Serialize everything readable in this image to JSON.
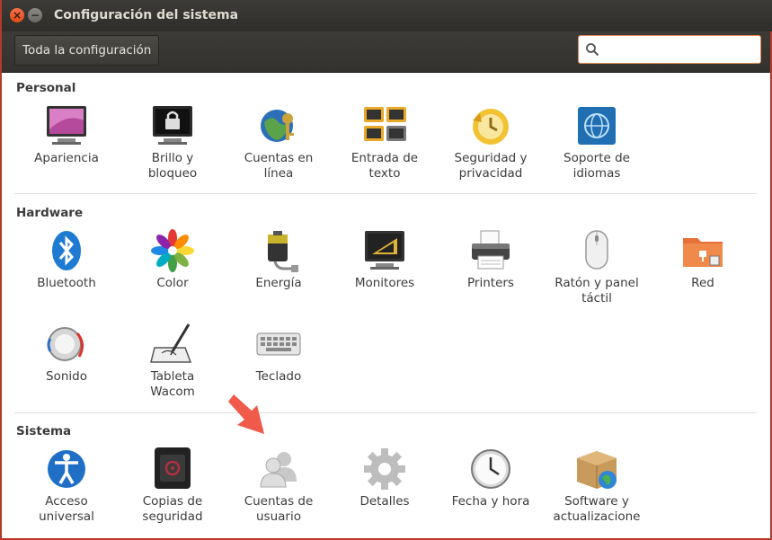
{
  "window": {
    "title": "Configuración del sistema"
  },
  "toolbar": {
    "all_settings_label": "Toda la configuración",
    "search_placeholder": ""
  },
  "sections": [
    {
      "title": "Personal",
      "items": [
        {
          "label_1": "Apariencia",
          "label_2": "",
          "icon": "appearance-icon"
        },
        {
          "label_1": "Brillo y",
          "label_2": "bloqueo",
          "icon": "brightness-lock-icon"
        },
        {
          "label_1": "Cuentas en",
          "label_2": "línea",
          "icon": "online-accounts-icon"
        },
        {
          "label_1": "Entrada de",
          "label_2": "texto",
          "icon": "text-entry-icon"
        },
        {
          "label_1": "Seguridad y",
          "label_2": "privacidad",
          "icon": "security-privacy-icon"
        },
        {
          "label_1": "Soporte de",
          "label_2": "idiomas",
          "icon": "language-support-icon"
        }
      ]
    },
    {
      "title": "Hardware",
      "items": [
        {
          "label_1": "Bluetooth",
          "label_2": "",
          "icon": "bluetooth-icon"
        },
        {
          "label_1": "Color",
          "label_2": "",
          "icon": "color-icon"
        },
        {
          "label_1": "Energía",
          "label_2": "",
          "icon": "power-icon"
        },
        {
          "label_1": "Monitores",
          "label_2": "",
          "icon": "displays-icon"
        },
        {
          "label_1": "Printers",
          "label_2": "",
          "icon": "printer-icon"
        },
        {
          "label_1": "Ratón y panel",
          "label_2": "táctil",
          "icon": "mouse-icon"
        },
        {
          "label_1": "Red",
          "label_2": "",
          "icon": "network-icon"
        },
        {
          "label_1": "Sonido",
          "label_2": "",
          "icon": "sound-icon"
        },
        {
          "label_1": "Tableta",
          "label_2": "Wacom",
          "icon": "wacom-tablet-icon"
        },
        {
          "label_1": "Teclado",
          "label_2": "",
          "icon": "keyboard-icon"
        }
      ]
    },
    {
      "title": "Sistema",
      "items": [
        {
          "label_1": "Acceso",
          "label_2": "universal",
          "icon": "universal-access-icon"
        },
        {
          "label_1": "Copias de",
          "label_2": "seguridad",
          "icon": "backup-icon"
        },
        {
          "label_1": "Cuentas de",
          "label_2": "usuario",
          "icon": "user-accounts-icon"
        },
        {
          "label_1": "Detalles",
          "label_2": "",
          "icon": "details-icon"
        },
        {
          "label_1": "Fecha y hora",
          "label_2": "",
          "icon": "date-time-icon"
        },
        {
          "label_1": "Software y",
          "label_2": "actualizacione",
          "icon": "software-updates-icon"
        }
      ]
    }
  ],
  "colors": {
    "accent": "#f05a4a",
    "titlebar": "#3c3b37",
    "search_border": "#e0894f"
  }
}
